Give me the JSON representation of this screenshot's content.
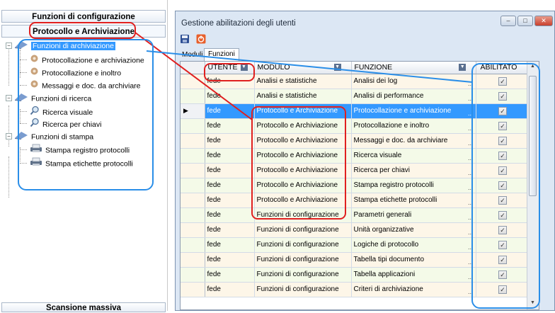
{
  "left_panel": {
    "header_config": "Funzioni di configurazione",
    "header_protocollo": "Protocollo e Archiviazione",
    "header_scansione": "Scansione massiva",
    "tree": [
      {
        "label": "Funzioni di archiviazione",
        "icon": "module-icon",
        "level": 0,
        "selected": true
      },
      {
        "label": "Protocollazione e archiviazione",
        "icon": "gear-icon",
        "level": 1
      },
      {
        "label": "Protocollazione e inoltro",
        "icon": "gear-icon",
        "level": 1
      },
      {
        "label": "Messaggi e doc. da archiviare",
        "icon": "gear-icon",
        "level": 1
      },
      {
        "label": "Funzioni di ricerca",
        "icon": "module-icon",
        "level": 0
      },
      {
        "label": "Ricerca visuale",
        "icon": "magnifier-icon",
        "level": 1
      },
      {
        "label": "Ricerca per chiavi",
        "icon": "magnifier-icon",
        "level": 1
      },
      {
        "label": "Funzioni di stampa",
        "icon": "module-icon",
        "level": 0
      },
      {
        "label": "Stampa registro protocolli",
        "icon": "printer-icon",
        "level": 1
      },
      {
        "label": "Stampa etichette protocolli",
        "icon": "printer-icon",
        "level": 1
      }
    ]
  },
  "window": {
    "title": "Gestione abilitazioni degli utenti",
    "tabs": {
      "moduli": "Moduli",
      "funzioni": "Funzioni"
    },
    "columns": {
      "utente": "UTENTE",
      "modulo": "MODULO",
      "funzione": "FUNZIONE",
      "abilitato": "ABILITATO"
    },
    "ellipsis": "...",
    "check_mark": "✓",
    "rows": [
      {
        "utente": "fede",
        "modulo": "Analisi e statistiche",
        "funzione": "Analisi dei log",
        "abilitato": true
      },
      {
        "utente": "fede",
        "modulo": "Analisi e statistiche",
        "funzione": "Analisi di performance",
        "abilitato": true
      },
      {
        "utente": "fede",
        "modulo": "Protocollo e Archiviazione",
        "funzione": "Protocollazione e archiviazione",
        "abilitato": true,
        "selected": true
      },
      {
        "utente": "fede",
        "modulo": "Protocollo e Archiviazione",
        "funzione": "Protocollazione e inoltro",
        "abilitato": true
      },
      {
        "utente": "fede",
        "modulo": "Protocollo e Archiviazione",
        "funzione": "Messaggi e doc. da archiviare",
        "abilitato": true
      },
      {
        "utente": "fede",
        "modulo": "Protocollo e Archiviazione",
        "funzione": "Ricerca visuale",
        "abilitato": true
      },
      {
        "utente": "fede",
        "modulo": "Protocollo e Archiviazione",
        "funzione": "Ricerca per chiavi",
        "abilitato": true
      },
      {
        "utente": "fede",
        "modulo": "Protocollo e Archiviazione",
        "funzione": "Stampa registro protocolli",
        "abilitato": true
      },
      {
        "utente": "fede",
        "modulo": "Protocollo e Archiviazione",
        "funzione": "Stampa etichette protocolli",
        "abilitato": true
      },
      {
        "utente": "fede",
        "modulo": "Funzioni di configurazione",
        "funzione": "Parametri generali",
        "abilitato": true
      },
      {
        "utente": "fede",
        "modulo": "Funzioni di configurazione",
        "funzione": "Unità organizzative",
        "abilitato": true
      },
      {
        "utente": "fede",
        "modulo": "Funzioni di configurazione",
        "funzione": "Logiche di protocollo",
        "abilitato": true
      },
      {
        "utente": "fede",
        "modulo": "Funzioni di configurazione",
        "funzione": "Tabella tipi documento",
        "abilitato": true
      },
      {
        "utente": "fede",
        "modulo": "Funzioni di configurazione",
        "funzione": "Tabella applicazioni",
        "abilitato": true
      },
      {
        "utente": "fede",
        "modulo": "Funzioni di configurazione",
        "funzione": "Criteri di archiviazione",
        "abilitato": true
      }
    ]
  },
  "colors": {
    "selection": "#3399ff",
    "annotation_red": "#e02020",
    "annotation_blue": "#2a8ee8"
  }
}
